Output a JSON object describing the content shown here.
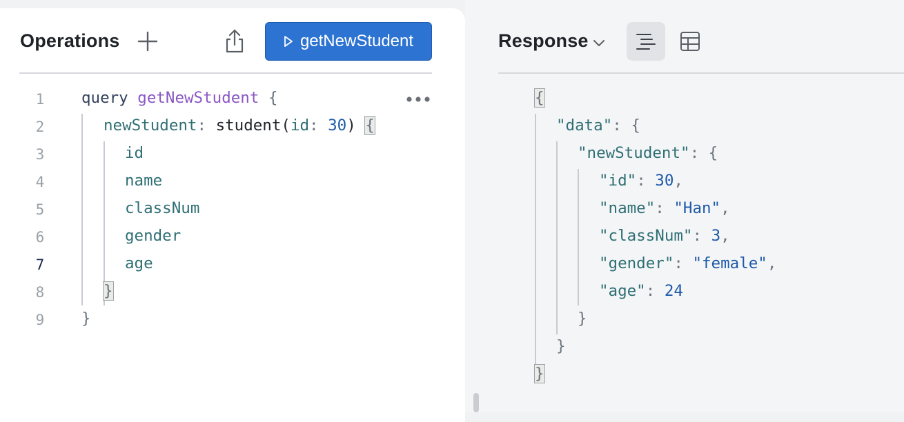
{
  "operations": {
    "title": "Operations",
    "run_label": "getNewStudent"
  },
  "editor": {
    "line_numbers": [
      "1",
      "2",
      "3",
      "4",
      "5",
      "6",
      "7",
      "8",
      "9"
    ],
    "q_keyword": "query",
    "q_name": "getNewStudent",
    "alias": "newStudent",
    "field": "student",
    "arg_name": "id",
    "arg_value": "30",
    "fields": [
      "id",
      "name",
      "classNum",
      "gender",
      "age"
    ]
  },
  "response": {
    "title": "Response",
    "key_data": "\"data\"",
    "key_newStudent": "\"newStudent\"",
    "rows": [
      {
        "key": "\"id\"",
        "value": "30",
        "type": "num",
        "comma": ","
      },
      {
        "key": "\"name\"",
        "value": "\"Han\"",
        "type": "str",
        "comma": ","
      },
      {
        "key": "\"classNum\"",
        "value": "3",
        "type": "num",
        "comma": ","
      },
      {
        "key": "\"gender\"",
        "value": "\"female\"",
        "type": "str",
        "comma": ","
      },
      {
        "key": "\"age\"",
        "value": "24",
        "type": "num",
        "comma": ""
      }
    ]
  }
}
